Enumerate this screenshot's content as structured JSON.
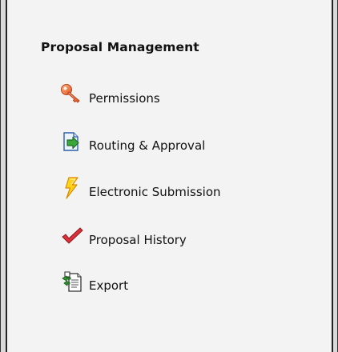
{
  "sidebar": {
    "title": "Proposal Management",
    "items": [
      {
        "label": "Permissions",
        "icon": "key-icon"
      },
      {
        "label": "Routing & Approval",
        "icon": "routing-document-icon"
      },
      {
        "label": "Electronic Submission",
        "icon": "lightning-icon"
      },
      {
        "label": "Proposal History",
        "icon": "checkmark-icon"
      },
      {
        "label": "Export",
        "icon": "export-icon"
      }
    ]
  },
  "colors": {
    "panel_background": "#f3f3f3",
    "frame_border": "#222222"
  }
}
